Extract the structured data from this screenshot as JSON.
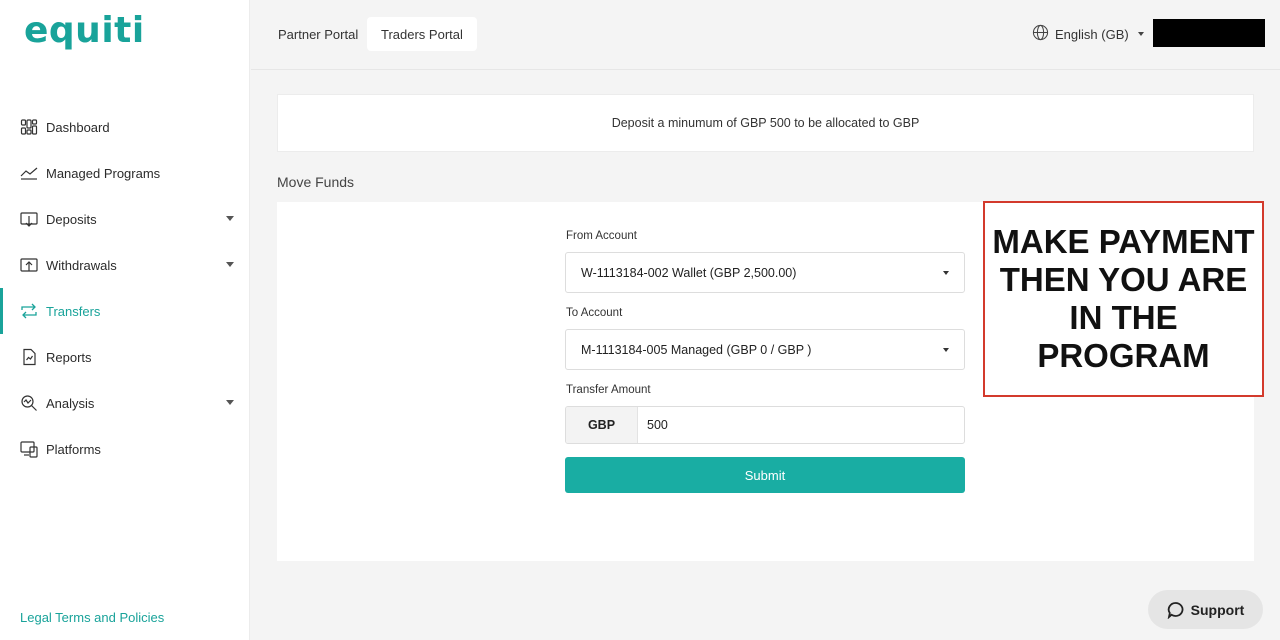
{
  "brand": {
    "logo_text": "equiti",
    "accent": "#19a39a"
  },
  "sidebar": {
    "items": [
      {
        "label": "Dashboard",
        "icon": "dashboard-icon",
        "has_dropdown": false
      },
      {
        "label": "Managed Programs",
        "icon": "trend-line-icon",
        "has_dropdown": false
      },
      {
        "label": "Deposits",
        "icon": "deposit-icon",
        "has_dropdown": true
      },
      {
        "label": "Withdrawals",
        "icon": "withdraw-icon",
        "has_dropdown": true
      },
      {
        "label": "Transfers",
        "icon": "transfer-icon",
        "has_dropdown": false,
        "active": true
      },
      {
        "label": "Reports",
        "icon": "report-icon",
        "has_dropdown": false
      },
      {
        "label": "Analysis",
        "icon": "analysis-icon",
        "has_dropdown": true
      },
      {
        "label": "Platforms",
        "icon": "platforms-icon",
        "has_dropdown": false
      }
    ],
    "legal_link": "Legal Terms and Policies"
  },
  "header": {
    "tabs": [
      {
        "label": "Partner Portal"
      },
      {
        "label": "Traders Portal",
        "active": true
      }
    ],
    "language": "English (GB)"
  },
  "notice": "Deposit a minumum of GBP 500 to be allocated to GBP",
  "move_funds": {
    "title": "Move Funds",
    "from_label": "From Account",
    "from_value": "W-1113184-002 Wallet (GBP 2,500.00)",
    "to_label": "To Account",
    "to_value": "M-1113184-005 Managed (GBP 0 / GBP )",
    "amount_label": "Transfer Amount",
    "currency": "GBP",
    "amount": "500",
    "submit_label": "Submit"
  },
  "callout": {
    "text": "MAKE PAYMENT THEN YOU ARE IN THE PROGRAM",
    "border_color": "#d33a2c"
  },
  "support": {
    "label": "Support"
  }
}
